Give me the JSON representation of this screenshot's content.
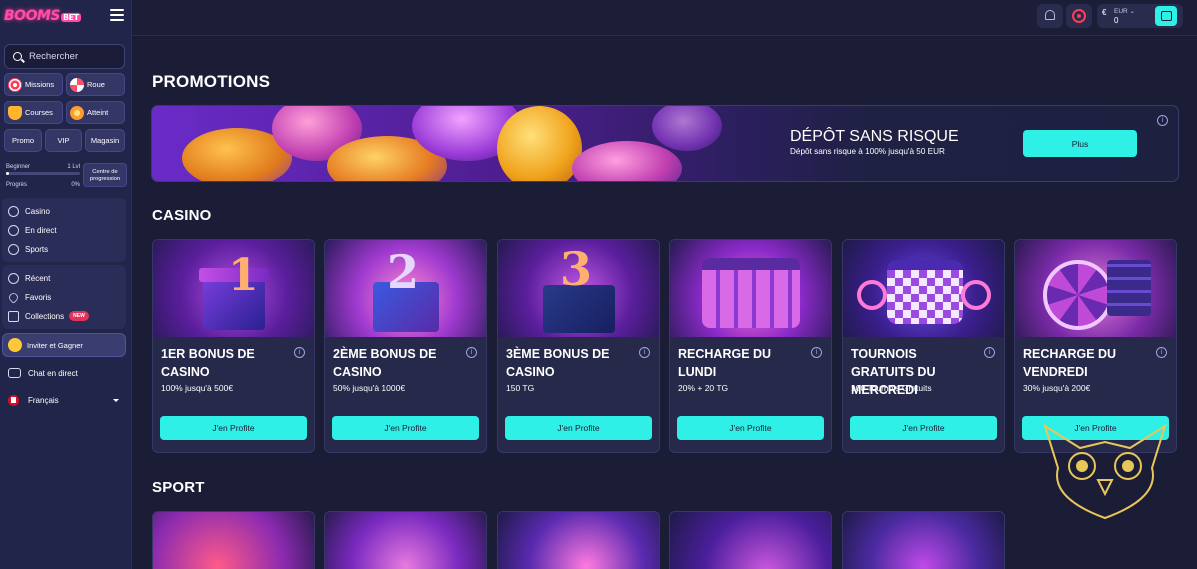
{
  "brand": {
    "name": "BOOMS",
    "suffix": "BET"
  },
  "sidebar": {
    "search_placeholder": "Rechercher",
    "chips": [
      {
        "label": "Missions",
        "icon": "target-icon"
      },
      {
        "label": "Roue",
        "icon": "wheel-icon"
      },
      {
        "label": "Courses",
        "icon": "trophy-icon"
      },
      {
        "label": "Atteint",
        "icon": "medal-icon"
      },
      {
        "label": "Promo"
      },
      {
        "label": "VIP"
      },
      {
        "label": "Magasin"
      }
    ],
    "progress": {
      "level_label": "Beginner",
      "level_value": "1 Lvl",
      "progress_label": "Progrès",
      "progress_value": "0%",
      "progress_fraction": 0.0,
      "center_button": "Centre de progression"
    },
    "nav_main": [
      {
        "label": "Casino",
        "icon": "casino-icon"
      },
      {
        "label": "En direct",
        "icon": "live-icon"
      },
      {
        "label": "Sports",
        "icon": "sports-icon"
      }
    ],
    "nav_secondary": [
      {
        "label": "Récent",
        "icon": "history-icon"
      },
      {
        "label": "Favoris",
        "icon": "heart-icon"
      },
      {
        "label": "Collections",
        "icon": "collections-icon",
        "badge": "NEW"
      }
    ],
    "invite_label": "Inviter et Gagner",
    "chat_label": "Chat en direct",
    "language_label": "Français"
  },
  "topbar": {
    "currency": "EUR",
    "balance": "0",
    "icons": [
      "bell-icon",
      "target-icon",
      "wallet-icon"
    ]
  },
  "main": {
    "promotions_title": "PROMOTIONS",
    "banner": {
      "title": "DÉPÔT SANS RISQUE",
      "subtitle": "Dépôt sans risque à 100% jusqu'à 50 EUR",
      "button": "Plus"
    },
    "casino_title": "CASINO",
    "casino_cards": [
      {
        "title": "1ER BONUS DE CASINO",
        "subtitle": "100% jusqu'à 500€",
        "button": "J'en Profite"
      },
      {
        "title": "2ÈME BONUS DE CASINO",
        "subtitle": "50% jusqu'à 1000€",
        "button": "J'en Profite"
      },
      {
        "title": "3ÈME BONUS DE CASINO",
        "subtitle": "150 TG",
        "button": "J'en Profite"
      },
      {
        "title": "RECHARGE DU LUNDI",
        "subtitle": "20% + 20 TG",
        "button": "J'en Profite"
      },
      {
        "title": "TOURNOIS GRATUITS DU MERCREDI",
        "subtitle": "100 Tournois Gratuits",
        "button": "J'en Profite"
      },
      {
        "title": "RECHARGE DU VENDREDI",
        "subtitle": "30% jusqu'à 200€",
        "button": "J'en Profite"
      }
    ],
    "sport_title": "SPORT"
  },
  "colors": {
    "accent": "#2ef0e6",
    "background": "#1b1d36",
    "sidebar": "#22254a",
    "card": "#262949"
  }
}
